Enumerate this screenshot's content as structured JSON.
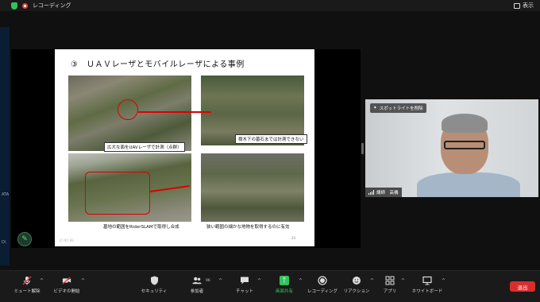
{
  "topbar": {
    "recording_label": "レコーディング",
    "view_label": "表示"
  },
  "left_edge": {
    "labels": [
      "ATA",
      "D\\"
    ]
  },
  "slide": {
    "title": "③　ＵＡＶレーザとモバイルレーザによる事例",
    "captions": [
      "広大な面をUAVレーザで計測（点群）",
      "樹木下の墓石までは計測できない",
      "墓地の範囲をRiderSLAMで取得し合成",
      "狭い範囲の細かな地物を取得するのに有効"
    ],
    "footer": "JC NO BE",
    "page_number": "20"
  },
  "video": {
    "spotlight_label": "スポットライトを削除",
    "participant_name": "講師　高橋"
  },
  "toolbar": {
    "mute_label": "ミュート解除",
    "video_label": "ビデオの開始",
    "security_label": "セキュリティ",
    "participants_label": "参加者",
    "participants_count": "96",
    "chat_label": "チャット",
    "share_label": "画面共有",
    "record_label": "レコーディング",
    "reaction_label": "リアクション",
    "apps_label": "アプリ",
    "whiteboard_label": "ホワイトボード",
    "end_label": "退出"
  },
  "colors": {
    "share_green": "#2ec45a",
    "end_red": "#d92d2d",
    "annotation_red": "#dd0000"
  }
}
